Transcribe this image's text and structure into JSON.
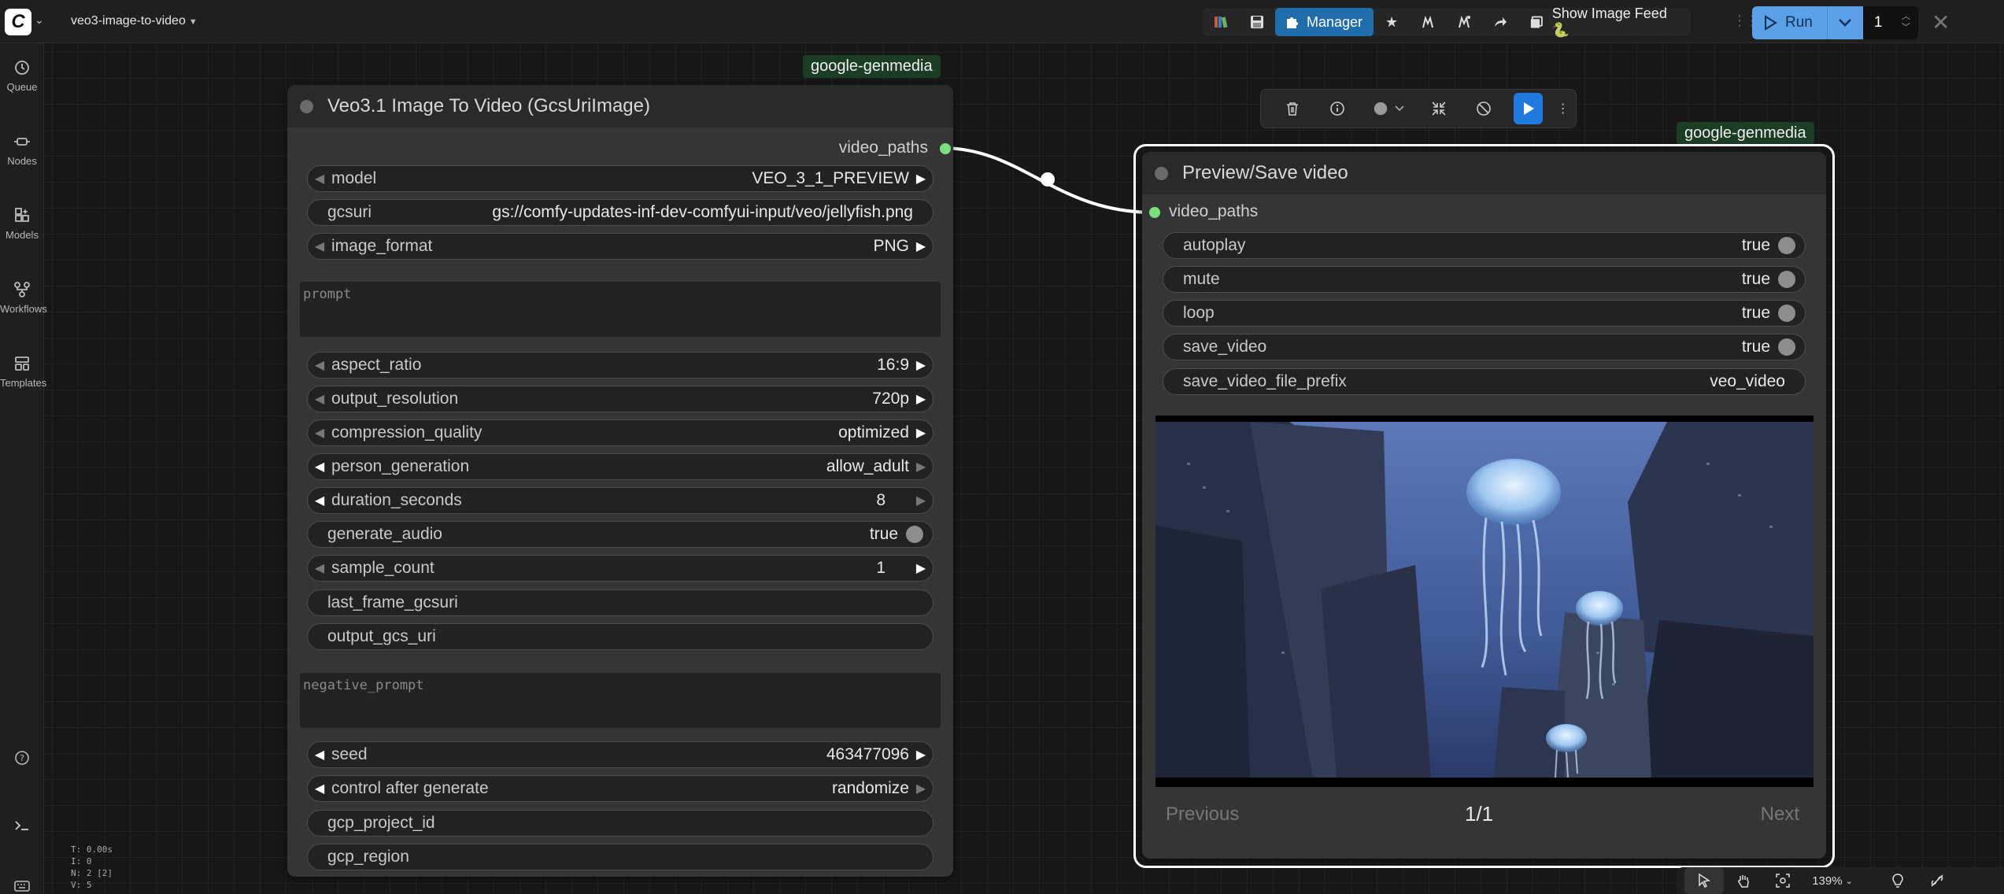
{
  "topbar": {
    "workflow_title": "veo3-image-to-video",
    "manager_label": "Manager",
    "show_feed_label": "Show Image Feed 🐍",
    "run_label": "Run",
    "run_count": "1"
  },
  "sidebar": {
    "items": [
      {
        "label": "Queue",
        "icon": "history-icon"
      },
      {
        "label": "Nodes",
        "icon": "nodes-icon"
      },
      {
        "label": "Models",
        "icon": "models-icon"
      },
      {
        "label": "Workflows",
        "icon": "workflows-icon"
      },
      {
        "label": "Templates",
        "icon": "templates-icon"
      }
    ]
  },
  "stats": {
    "t": "T: 0.00s",
    "i": "I: 0",
    "n": "N: 2 [2]",
    "v": "V: 5"
  },
  "veo_node": {
    "badge": "google-genmedia",
    "title": "Veo3.1 Image To Video (GcsUriImage)",
    "output_label": "video_paths",
    "widgets": [
      {
        "label": "model",
        "value": "VEO_3_1_PREVIEW"
      },
      {
        "label": "gcsuri",
        "value": "gs://comfy-updates-inf-dev-comfyui-input/veo/jellyfish.png"
      },
      {
        "label": "image_format",
        "value": "PNG"
      },
      {
        "label": "aspect_ratio",
        "value": "16:9"
      },
      {
        "label": "output_resolution",
        "value": "720p"
      },
      {
        "label": "compression_quality",
        "value": "optimized"
      },
      {
        "label": "person_generation",
        "value": "allow_adult"
      },
      {
        "label": "duration_seconds",
        "value": "8"
      },
      {
        "label": "generate_audio",
        "value": "true"
      },
      {
        "label": "sample_count",
        "value": "1"
      },
      {
        "label": "last_frame_gcsuri",
        "value": ""
      },
      {
        "label": "output_gcs_uri",
        "value": ""
      },
      {
        "label": "seed",
        "value": "463477096"
      },
      {
        "label": "control after generate",
        "value": "randomize"
      },
      {
        "label": "gcp_project_id",
        "value": ""
      },
      {
        "label": "gcp_region",
        "value": ""
      }
    ],
    "prompt_placeholder": "prompt",
    "negative_prompt_placeholder": "negative_prompt"
  },
  "preview_node": {
    "badge": "google-genmedia",
    "title": "Preview/Save video",
    "input_label": "video_paths",
    "widgets": [
      {
        "label": "autoplay",
        "value": "true"
      },
      {
        "label": "mute",
        "value": "true"
      },
      {
        "label": "loop",
        "value": "true"
      },
      {
        "label": "save_video",
        "value": "true"
      },
      {
        "label": "save_video_file_prefix",
        "value": "veo_video"
      }
    ],
    "previous_label": "Previous",
    "page_label": "1/1",
    "next_label": "Next"
  },
  "canvas_tools": {
    "zoom": "139%"
  },
  "colors": {
    "accent": "#1f6dac",
    "run": "#5aa1e8",
    "slot": "#7be07b",
    "badge_bg": "#1a3d23"
  }
}
